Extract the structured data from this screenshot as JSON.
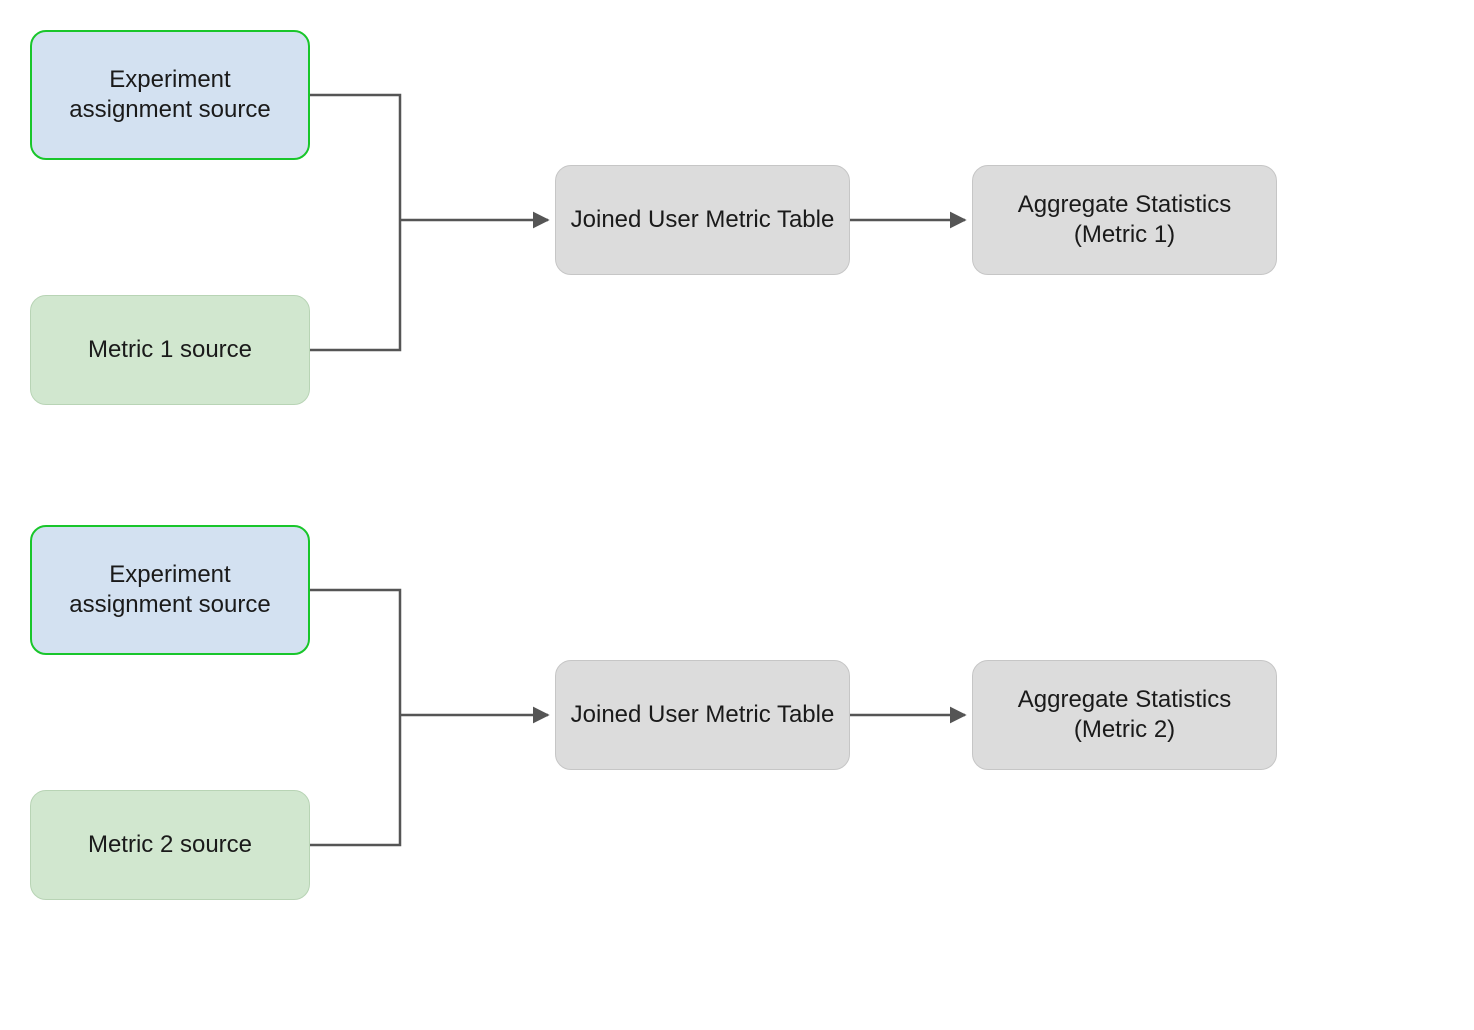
{
  "flows": [
    {
      "exp_source": "Experiment assignment source",
      "metric_source": "Metric 1 source",
      "join": "Joined User Metric Table",
      "aggregate": "Aggregate Statistics (Metric 1)"
    },
    {
      "exp_source": "Experiment assignment source",
      "metric_source": "Metric 2 source",
      "join": "Joined User Metric Table",
      "aggregate": "Aggregate Statistics (Metric 2)"
    }
  ],
  "colors": {
    "experiment_fill": "#d3e1f1",
    "experiment_border": "#19c62b",
    "metric_fill": "#d1e7cf",
    "process_fill": "#dcdcdc",
    "edge": "#555555"
  }
}
